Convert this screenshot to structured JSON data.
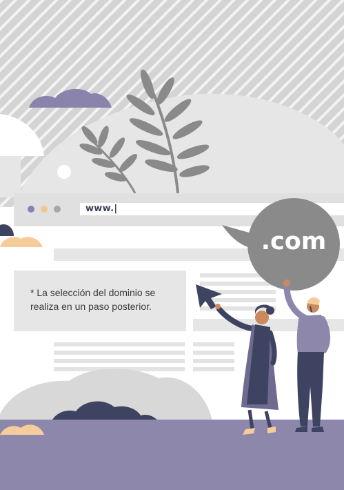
{
  "browser": {
    "url_text": "www.|",
    "dots": [
      "#8a7fb0",
      "#f3c68f",
      "#a6a6a6"
    ]
  },
  "domain_bubble": {
    "text": ".com"
  },
  "note": {
    "text": "* La selección del dominio se realiza en un paso posterior."
  },
  "colors": {
    "stripe_bg": "#d4d4d4",
    "hill": "#e6e6e6",
    "ground": "#8c87ab",
    "bubble": "#8a8a8a",
    "leaf": "#8a8a8a",
    "navy": "#3d4360",
    "peach": "#f6cd9a"
  }
}
